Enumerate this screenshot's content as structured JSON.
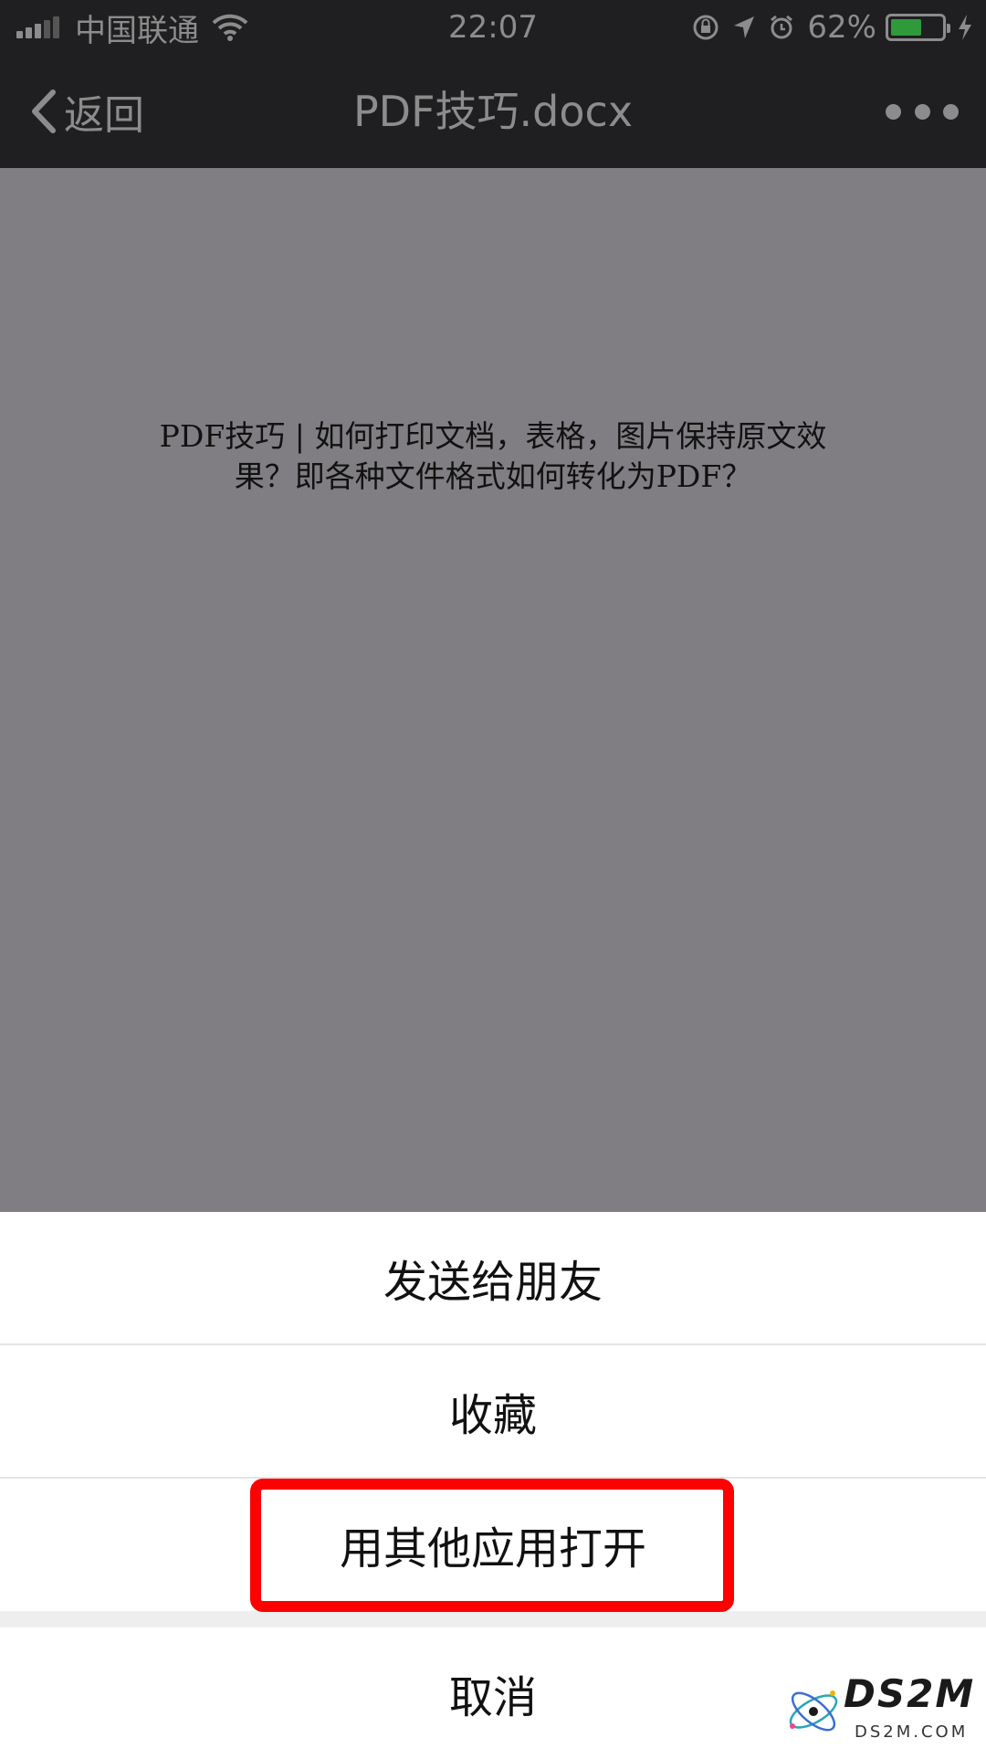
{
  "status_bar": {
    "carrier": "中国联通",
    "time": "22:07",
    "battery_percent": "62%",
    "battery_level": 0.62,
    "colors": {
      "battery_fill": "#2e9a3a",
      "bar_bg": "#1f1f21",
      "text": "#8c8c8c"
    }
  },
  "navbar": {
    "back_label": "返回",
    "title": "PDF技巧.docx"
  },
  "document": {
    "lines": [
      "PDF技巧 | 如何打印文档，表格，图片保持原文效",
      "果？即各种文件格式如何转化为PDF？"
    ]
  },
  "action_sheet": {
    "items": [
      {
        "label": "发送给朋友"
      },
      {
        "label": "收藏"
      },
      {
        "label": "用其他应用打开"
      }
    ],
    "cancel_label": "取消",
    "highlight_color": "#ff0000"
  },
  "watermark": {
    "brand": "DS2M",
    "url": "DS2M.COM"
  }
}
